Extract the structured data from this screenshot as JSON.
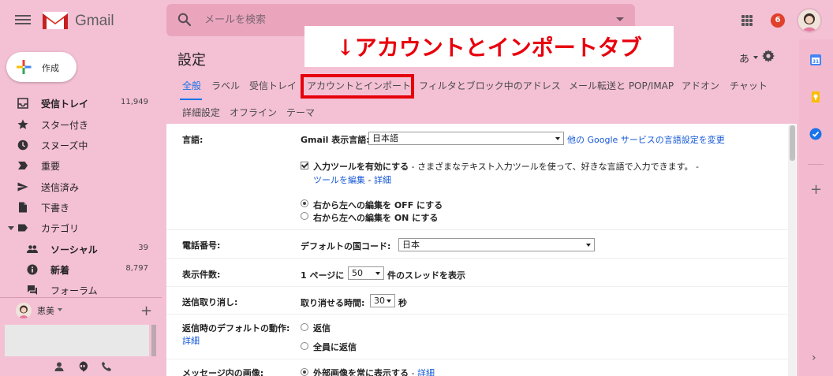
{
  "header": {
    "app_name": "Gmail",
    "search_placeholder": "メールを検索",
    "notification_count": "6"
  },
  "callout": {
    "text": "↓アカウントとインポートタブ"
  },
  "sidebar": {
    "compose_label": "作成",
    "items": [
      {
        "label": "受信トレイ",
        "count": "11,949",
        "icon": "inbox-icon",
        "bold": true
      },
      {
        "label": "スター付き",
        "count": "",
        "icon": "star-icon"
      },
      {
        "label": "スヌーズ中",
        "count": "",
        "icon": "clock-icon"
      },
      {
        "label": "重要",
        "count": "",
        "icon": "important-icon"
      },
      {
        "label": "送信済み",
        "count": "",
        "icon": "send-icon"
      },
      {
        "label": "下書き",
        "count": "",
        "icon": "draft-icon"
      },
      {
        "label": "カテゴリ",
        "count": "",
        "icon": "label-icon"
      },
      {
        "label": "ソーシャル",
        "count": "39",
        "icon": "people-icon",
        "bold": true
      },
      {
        "label": "新着",
        "count": "8,797",
        "icon": "info-icon",
        "bold": true
      },
      {
        "label": "フォーラム",
        "count": "",
        "icon": "forum-icon"
      }
    ],
    "hangouts_user": "恵美"
  },
  "main": {
    "page_title": "設定",
    "input_tools_label": "あ",
    "tabs_row1": [
      "全般",
      "ラベル",
      "受信トレイ",
      "アカウントとインポート",
      "フィルタとブロック中のアドレス",
      "メール転送と POP/IMAP",
      "アドオン",
      "チャット"
    ],
    "tabs_row2": [
      "詳細設定",
      "オフライン",
      "テーマ"
    ],
    "active_tab": "全般",
    "highlighted_tab": "アカウントとインポート"
  },
  "settings": {
    "language": {
      "label": "言語:",
      "display_language_label": "Gmail 表示言語:",
      "display_language_value": "日本語",
      "other_services_link": "他の Google サービスの言語設定を変更",
      "input_tools_text": "入力ツールを有効にする",
      "input_tools_desc": " - さまざまなテキスト入力ツールを使って、好きな言語で入力できます。 -",
      "edit_tools_link": "ツールを編集",
      "separator": " - ",
      "details_link": "詳細",
      "rtl_off": "右から左への編集を OFF にする",
      "rtl_on": "右から左への編集を ON にする"
    },
    "phone": {
      "label": "電話番号:",
      "country_code_label": "デフォルトの国コード:",
      "country_code_value": "日本"
    },
    "page_size": {
      "label": "表示件数:",
      "prefix": "1 ページに",
      "value": "50",
      "suffix": "件のスレッドを表示"
    },
    "undo_send": {
      "label": "送信取り消し:",
      "period_label": "取り消せる時間:",
      "value": "30",
      "unit": "秒"
    },
    "reply_default": {
      "label": "返信時のデフォルトの動作:",
      "details_link": "詳細",
      "reply": "返信",
      "reply_all": "全員に返信"
    },
    "images": {
      "label": "メッセージ内の画像:",
      "always_show": "外部画像を常に表示する",
      "separator": " - ",
      "details_link": "詳細"
    }
  },
  "colors": {
    "theme_background": "#f4c0d4",
    "callout_red": "#e8000d",
    "link_blue": "#1558d6",
    "active_tab_blue": "#1a73e8"
  }
}
